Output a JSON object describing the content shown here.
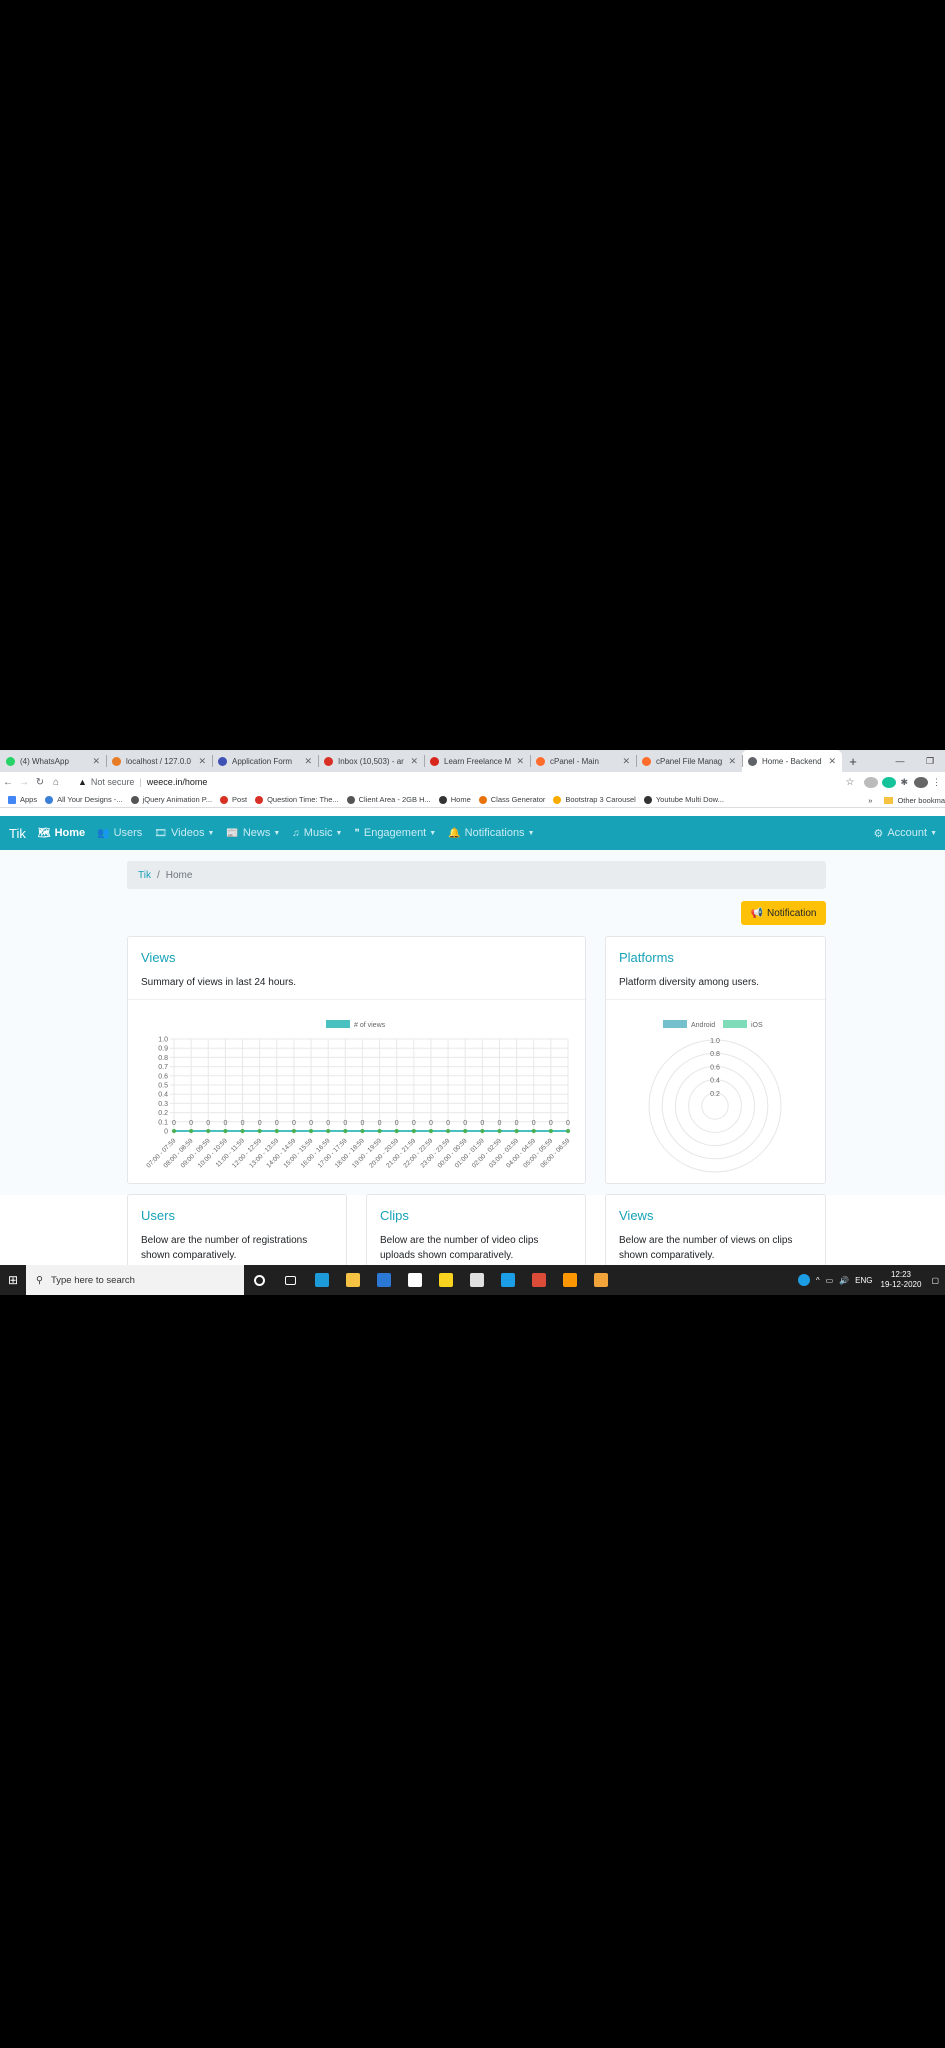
{
  "browser": {
    "tabs": [
      {
        "label": "(4) WhatsApp",
        "color": "#25d366",
        "active": false
      },
      {
        "label": "localhost / 127.0.0",
        "color": "#e87b25",
        "active": false
      },
      {
        "label": "Application Form",
        "color": "#3f51b5",
        "active": false
      },
      {
        "label": "Inbox (10,503) - ar",
        "color": "#d93025",
        "active": false
      },
      {
        "label": "Learn Freelance M",
        "color": "#d9261c",
        "active": false
      },
      {
        "label": "cPanel - Main",
        "color": "#ff6c2c",
        "active": false
      },
      {
        "label": "cPanel File Manag",
        "color": "#ff6c2c",
        "active": false
      },
      {
        "label": "Home - Backend",
        "color": "#5f6368",
        "active": true
      }
    ],
    "new_tab": "+",
    "address": {
      "security": "Not secure",
      "url": "weece.in/home"
    },
    "bookmarks": [
      {
        "label": "Apps",
        "color": "#4285f4"
      },
      {
        "label": "All Your Designs -...",
        "color": "#3b7fd9"
      },
      {
        "label": "jQuery Animation P...",
        "color": "#555555"
      },
      {
        "label": "Post",
        "color": "#d93025"
      },
      {
        "label": "Question Time: The...",
        "color": "#d93025"
      },
      {
        "label": "Client Area - 2GB H...",
        "color": "#555555"
      },
      {
        "label": "Home",
        "color": "#333333"
      },
      {
        "label": "Class Generator",
        "color": "#e8710a"
      },
      {
        "label": "Bootstrap 3 Carousel",
        "color": "#f9ab00"
      },
      {
        "label": "Youtube Multi Dow...",
        "color": "#333333"
      }
    ],
    "bookmarks_more": "»",
    "other_bookmarks": "Other bookma"
  },
  "navbar": {
    "brand": "Tik",
    "items": [
      {
        "label": "Home",
        "icon": "map-icon",
        "glyph": "🗺",
        "dropdown": false,
        "active": true
      },
      {
        "label": "Users",
        "icon": "users-icon",
        "glyph": "👥",
        "dropdown": false,
        "active": false
      },
      {
        "label": "Videos",
        "icon": "film-icon",
        "glyph": "🎞",
        "dropdown": true,
        "active": false
      },
      {
        "label": "News",
        "icon": "newspaper-icon",
        "glyph": "📰",
        "dropdown": true,
        "active": false
      },
      {
        "label": "Music",
        "icon": "music-icon",
        "glyph": "♫",
        "dropdown": true,
        "active": false
      },
      {
        "label": "Engagement",
        "icon": "quote-icon",
        "glyph": "❞",
        "dropdown": true,
        "active": false
      },
      {
        "label": "Notifications",
        "icon": "bell-icon",
        "glyph": "🔔",
        "dropdown": true,
        "active": false
      }
    ],
    "account": {
      "label": "Account",
      "icon": "gear-icon",
      "glyph": "⚙"
    }
  },
  "breadcrumb": {
    "root": "Tik",
    "separator": "/",
    "current": "Home"
  },
  "notification_button": {
    "label": "Notification",
    "icon": "bullhorn-icon",
    "glyph": "📢"
  },
  "cards": {
    "views": {
      "title": "Views",
      "subtitle": "Summary of views in last 24 hours."
    },
    "platforms": {
      "title": "Platforms",
      "subtitle": "Platform diversity among users."
    },
    "users": {
      "title": "Users",
      "text": "Below are the number of registrations shown comparatively."
    },
    "clips": {
      "title": "Clips",
      "text": "Below are the number of video clips uploads shown comparatively."
    },
    "views_bottom": {
      "title": "Views",
      "text": "Below are the number of views on clips shown comparatively."
    }
  },
  "chart_data": [
    {
      "type": "line",
      "legend": "# of views",
      "legend_position": "top",
      "color": "#4bc0c0",
      "grid": true,
      "ylim": [
        0,
        1.0
      ],
      "yticks": [
        "1.0",
        "0.9",
        "0.8",
        "0.7",
        "0.6",
        "0.5",
        "0.4",
        "0.3",
        "0.2",
        "0.1",
        "0"
      ],
      "categories": [
        "07:00 - 07:59",
        "08:00 - 08:59",
        "09:00 - 09:59",
        "10:00 - 10:59",
        "11:00 - 11:59",
        "12:00 - 12:59",
        "13:00 - 13:59",
        "14:00 - 14:59",
        "15:00 - 15:59",
        "16:00 - 16:59",
        "17:00 - 17:59",
        "18:00 - 18:59",
        "19:00 - 19:59",
        "20:00 - 20:59",
        "21:00 - 21:59",
        "22:00 - 22:59",
        "23:00 - 23:59",
        "00:00 - 00:59",
        "01:00 - 01:59",
        "02:00 - 02:59",
        "03:00 - 03:59",
        "04:00 - 04:59",
        "05:00 - 05:59",
        "06:00 - 06:59"
      ],
      "values": [
        0,
        0,
        0,
        0,
        0,
        0,
        0,
        0,
        0,
        0,
        0,
        0,
        0,
        0,
        0,
        0,
        0,
        0,
        0,
        0,
        0,
        0,
        0,
        0
      ]
    },
    {
      "type": "radar",
      "series": [
        {
          "name": "Android",
          "color": "#74c0cc"
        },
        {
          "name": "iOS",
          "color": "#7fdcb8"
        }
      ],
      "legend_position": "top",
      "rticks": [
        "1.0",
        "0.8",
        "0.6",
        "0.4",
        "0.2"
      ],
      "rlim": [
        0,
        1.0
      ]
    }
  ],
  "taskbar": {
    "search_placeholder": "Type here to search",
    "language": "ENG",
    "time": "12:23",
    "date": "19-12-2020",
    "apps": [
      {
        "icon": "cortana-icon",
        "color": "#ffffff"
      },
      {
        "icon": "task-view-icon",
        "color": "#ffffff"
      },
      {
        "icon": "edge-icon",
        "color": "#1d9bd9"
      },
      {
        "icon": "file-explorer-icon",
        "color": "#f6c244"
      },
      {
        "icon": "mail-icon",
        "color": "#2b78d6"
      },
      {
        "icon": "dropbox-icon",
        "color": "#ffffff"
      },
      {
        "icon": "sticky-notes-icon",
        "color": "#f7d21f"
      },
      {
        "icon": "winamp-icon",
        "color": "#e0e0e0"
      },
      {
        "icon": "skype-icon",
        "color": "#1c9ee6"
      },
      {
        "icon": "chrome-icon",
        "color": "#dd4b39"
      },
      {
        "icon": "sublime-icon",
        "color": "#ff9800"
      },
      {
        "icon": "paint-icon",
        "color": "#f2a33a"
      }
    ]
  }
}
